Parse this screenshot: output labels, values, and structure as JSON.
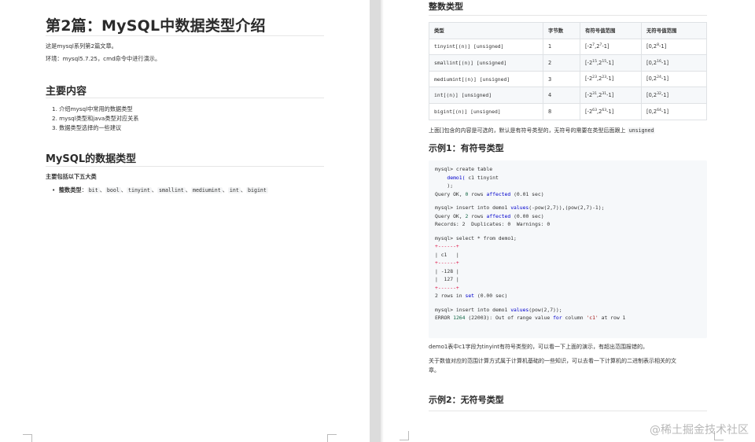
{
  "left": {
    "title": "第2篇：MySQL中数据类型介绍",
    "intro1": "这是mysql系列第2篇文章。",
    "intro2": "环境：mysql5.7.25，cmd命令中进行演示。",
    "section_main": "主要内容",
    "main_items": [
      "1. 介绍mysql中常用的数据类型",
      "2. mysql类型和java类型对应关系",
      "3. 数据类型选择的一些建议"
    ],
    "section_types": "MySQL的数据类型",
    "types_intro": "主要包括以下五大类",
    "bullet_label": "整数类型",
    "bullet_sep": "：",
    "bullet_types": [
      "bit",
      "bool",
      "tinyint",
      "smallint",
      "mediumint",
      "int",
      "bigint"
    ],
    "comma": "、"
  },
  "right": {
    "section_int": "整数类型",
    "table": {
      "headers": [
        "类型",
        "字节数",
        "有符号值范围",
        "无符号值范围"
      ],
      "rows": [
        {
          "type": "tinyint[(n)] [unsigned]",
          "bytes": "1",
          "s_a": "7",
          "s_b": "7",
          "u_a": "8"
        },
        {
          "type": "smallint[(n)] [unsigned]",
          "bytes": "2",
          "s_a": "15",
          "s_b": "15",
          "u_a": "16"
        },
        {
          "type": "mediumint[(n)] [unsigned]",
          "bytes": "3",
          "s_a": "23",
          "s_b": "23",
          "u_a": "24"
        },
        {
          "type": "int[(n)] [unsigned]",
          "bytes": "4",
          "s_a": "31",
          "s_b": "31",
          "u_a": "32"
        },
        {
          "type": "bigint[(n)] [unsigned]",
          "bytes": "8",
          "s_a": "63",
          "s_b": "63",
          "u_a": "64"
        }
      ]
    },
    "note": "上面[]包含的内容是可选的，默认是有符号类型的，无符号的需要在类型后面跟上",
    "note_code": "unsigned",
    "example1": "示例1：有符号类型",
    "code": {
      "l1a": "mysql> create table",
      "l2": "demo1(",
      "l2b": " c1 tinyint",
      "l3": "    );",
      "l4a": "Query OK, ",
      "l4n": "0",
      "l4b": " rows ",
      "l4k": "affected",
      "l4c": " (0.01 sec)",
      "l5a": "mysql> insert into demo1 ",
      "l5k": "values",
      "l5b": "(-pow(2,7)),(pow(2,7)-1);",
      "l6a": "Query OK, ",
      "l6n": "2",
      "l6b": " rows ",
      "l6k": "affected",
      "l6c": " (0.00 sec)",
      "l7": "Records: 2  Duplicates: 0  Warnings: 0",
      "l8": "mysql> select * from demo1;",
      "l9": "+------+",
      "l10": "| c1   |",
      "l11": "+------+",
      "l12": "| -128 |",
      "l13": "|  127 |",
      "l14": "+------+",
      "l15a": "2 rows in ",
      "l15k": "set",
      "l15b": " (0.00 sec)",
      "l16a": "mysql> insert into demo1 ",
      "l16k": "values",
      "l16b": "(pow(2,7));",
      "l17a": "ERROR ",
      "l17n": "1264",
      "l17b": " (22003): Out of range value ",
      "l17k": "for",
      "l17c": " column ",
      "l17s": "'c1'",
      "l17d": " at row 1"
    },
    "para1": "demo1表中c1字段为tinyint有符号类型的，可以看一下上面的演示，有超出范围报错的。",
    "para2a": "关于数值对应的范围计算方式属于计算机基础的一些知识，可以去看一下计算机的二进制表示相关的文",
    "para2b": "章。",
    "example2": "示例2：无符号类型"
  },
  "watermark": "@稀土掘金技术社区"
}
